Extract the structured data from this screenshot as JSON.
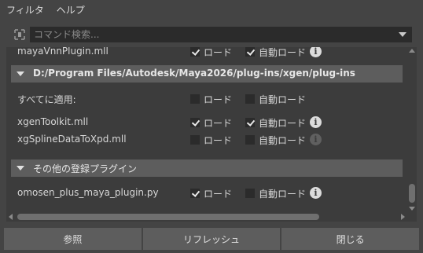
{
  "menubar": {
    "items": [
      "フィルタ",
      "ヘルプ"
    ]
  },
  "search": {
    "placeholder": "コマンド検索..."
  },
  "top_partial_row": {
    "name": "mayaVnnPlugin.mll",
    "load_label": "ロード",
    "autoload_label": "自動ロード"
  },
  "section_xgen": {
    "title": "D:/Program Files/Autodesk/Maya2026/plug-ins/xgen/plug-ins"
  },
  "apply_all": {
    "name": "すべてに適用:",
    "load_label": "ロード",
    "load_checked": false,
    "autoload_label": "自動ロード",
    "autoload_checked": false
  },
  "plugins": [
    {
      "name": "xgenToolkit.mll",
      "load_label": "ロード",
      "load_checked": true,
      "autoload_label": "自動ロード",
      "autoload_checked": true,
      "info": "i",
      "info_active": true
    },
    {
      "name": "xgSplineDataToXpd.mll",
      "load_label": "ロード",
      "load_checked": false,
      "autoload_label": "自動ロード",
      "autoload_checked": false,
      "info": "i",
      "info_active": false
    }
  ],
  "section_other": {
    "title": "その他の登録プラグイン"
  },
  "other_plugins": [
    {
      "name": "omosen_plus_maya_plugin.py",
      "load_label": "ロード",
      "load_checked": true,
      "autoload_label": "自動ロード",
      "autoload_checked": false,
      "info": "i",
      "info_active": true
    }
  ],
  "buttons": {
    "browse": "参照",
    "refresh": "リフレッシュ",
    "close": "閉じる"
  },
  "colors": {
    "background": "#444444",
    "panel": "#3c3c3c",
    "section": "#5d5d5d",
    "field": "#2b2b2b"
  }
}
